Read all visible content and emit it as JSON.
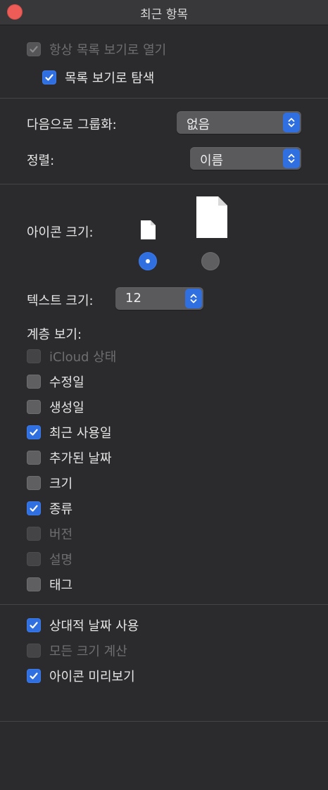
{
  "window": {
    "title": "최근 항목"
  },
  "top_options": [
    {
      "label": "항상 목록 보기로 열기",
      "state": "checked-disabled"
    },
    {
      "label": "목록 보기로 탐색",
      "state": "checked"
    }
  ],
  "group_by": {
    "label": "다음으로 그룹화:",
    "value": "없음"
  },
  "sort_by": {
    "label": "정렬:",
    "value": "이름"
  },
  "icon_size": {
    "label": "아이콘 크기:",
    "selected": "small"
  },
  "text_size": {
    "label": "텍스트 크기:",
    "value": "12"
  },
  "columns": {
    "label": "계층 보기:",
    "items": [
      {
        "label": "iCloud 상태",
        "state": "disabled"
      },
      {
        "label": "수정일",
        "state": "unchecked"
      },
      {
        "label": "생성일",
        "state": "unchecked"
      },
      {
        "label": "최근 사용일",
        "state": "checked"
      },
      {
        "label": "추가된 날짜",
        "state": "unchecked"
      },
      {
        "label": "크기",
        "state": "unchecked"
      },
      {
        "label": "종류",
        "state": "checked"
      },
      {
        "label": "버전",
        "state": "disabled"
      },
      {
        "label": "설명",
        "state": "disabled"
      },
      {
        "label": "태그",
        "state": "unchecked"
      }
    ]
  },
  "bottom_options": [
    {
      "label": "상대적 날짜 사용",
      "state": "checked"
    },
    {
      "label": "모든 크기 계산",
      "state": "disabled"
    },
    {
      "label": "아이콘 미리보기",
      "state": "checked"
    }
  ],
  "colors": {
    "accent": "#2f6fe0",
    "close": "#ed5c57",
    "background": "#2b2b2d"
  }
}
